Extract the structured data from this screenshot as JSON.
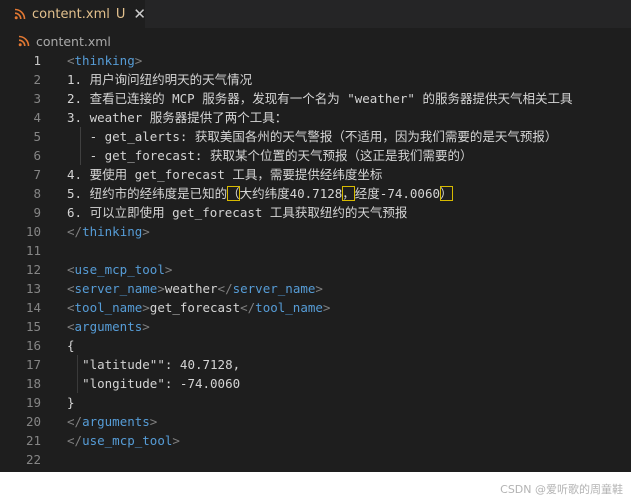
{
  "tab": {
    "filename": "content.xml",
    "status": "U",
    "close_glyph": "✕"
  },
  "breadcrumb": {
    "filename": "content.xml"
  },
  "editor": {
    "active_line": 1,
    "lines": [
      {
        "n": "1",
        "text": "<thinking>"
      },
      {
        "n": "2",
        "text": "1. 用户询问纽约明天的天气情况"
      },
      {
        "n": "3",
        "text": "2. 查看已连接的 MCP 服务器，发现有一个名为 \"weather\" 的服务器提供天气相关工具"
      },
      {
        "n": "4",
        "text": "3. weather 服务器提供了两个工具："
      },
      {
        "n": "5",
        "text": "   - get_alerts: 获取美国各州的天气警报（不适用，因为我们需要的是天气预报）"
      },
      {
        "n": "6",
        "text": "   - get_forecast: 获取某个位置的天气预报（这正是我们需要的）"
      },
      {
        "n": "7",
        "text": "4. 要使用 get_forecast 工具，需要提供经纬度坐标"
      },
      {
        "n": "8",
        "text": "5. 纽约市的经纬度是已知的（大约纬度40.7128，经度-74.0060）"
      },
      {
        "n": "9",
        "text": "6. 可以立即使用 get_forecast 工具获取纽约的天气预报"
      },
      {
        "n": "10",
        "text": "</thinking>"
      },
      {
        "n": "11",
        "text": ""
      },
      {
        "n": "12",
        "text": "<use_mcp_tool>"
      },
      {
        "n": "13",
        "text": "<server_name>weather</server_name>"
      },
      {
        "n": "14",
        "text": "<tool_name>get_forecast</tool_name>"
      },
      {
        "n": "15",
        "text": "<arguments>"
      },
      {
        "n": "16",
        "text": "{"
      },
      {
        "n": "17",
        "text": "  \"latitude\"\": 40.7128,"
      },
      {
        "n": "18",
        "text": "  \"longitude\": -74.0060"
      },
      {
        "n": "19",
        "text": "}"
      },
      {
        "n": "20",
        "text": "</arguments>"
      },
      {
        "n": "21",
        "text": "</use_mcp_tool>"
      },
      {
        "n": "22",
        "text": ""
      }
    ],
    "segments": {
      "l8_prefix": "5. 纽约市的经纬度是已知的",
      "l8_open": "（",
      "l8_lat": "大约纬度40.7128",
      "l8_comma": "，",
      "l8_lon": "经度-74.0060",
      "l8_close": "）",
      "t_thinking": "thinking",
      "t_use": "use_mcp_tool",
      "t_server": "server_name",
      "v_server": "weather",
      "t_tool": "tool_name",
      "v_tool": "get_forecast",
      "t_args": "arguments",
      "k_lat": "\"latitude\"\"",
      "v_lat": "40.7128",
      "k_lon": "\"longitude\"",
      "v_lon": "-74.0060"
    }
  },
  "watermark": "CSDN @爱听歌的周童鞋",
  "colors": {
    "modified": "#e2c08d",
    "tag": "#569cd6",
    "bracket_highlight": "#d7ba00",
    "rss_icon": "#e37933"
  }
}
